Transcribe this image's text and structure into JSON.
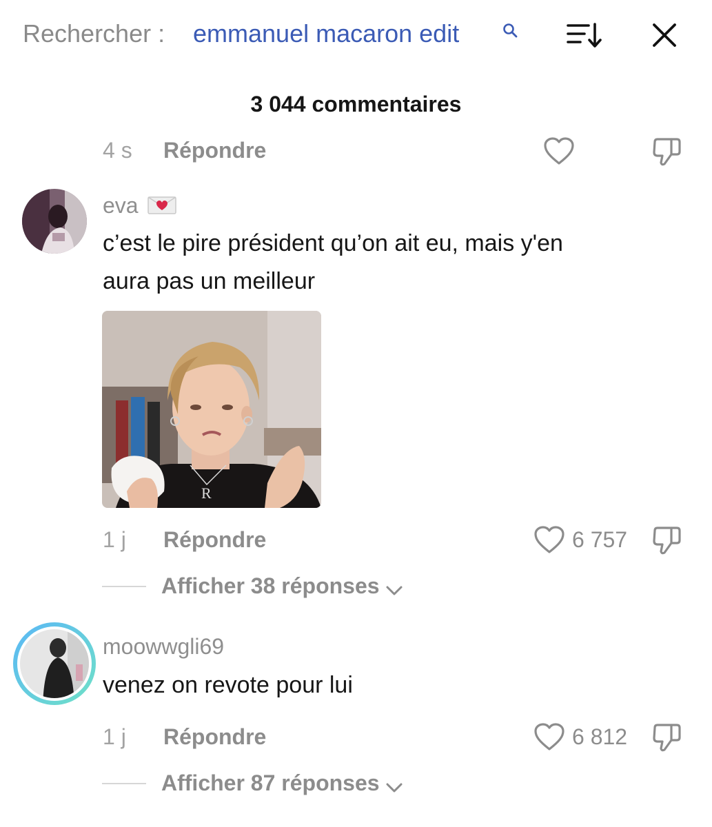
{
  "header": {
    "search_prefix": "Rechercher :",
    "search_query": "emmanuel macaron edit",
    "search_icon": "search-icon",
    "sort_icon": "sort-icon",
    "close_icon": "close-icon",
    "accent_color": "#3b5bb5"
  },
  "comment_count": "3 044 commentaires",
  "previous_comment": {
    "time": "4 s",
    "reply_label": "Répondre"
  },
  "comments": [
    {
      "username": "eva",
      "username_badge": "love-letter-emoji",
      "text_line1": "c’est le pire président qu’on ait eu, mais y'en",
      "text_line2": "aura pas un meilleur",
      "has_gif": true,
      "time": "1 j",
      "reply_label": "Répondre",
      "likes": "6 757",
      "show_replies": "Afficher 38 réponses"
    },
    {
      "username": "moowwgli69",
      "text_line1": "venez on revote pour lui",
      "time": "1 j",
      "reply_label": "Répondre",
      "likes": "6 812",
      "show_replies": "Afficher 87 réponses"
    }
  ]
}
